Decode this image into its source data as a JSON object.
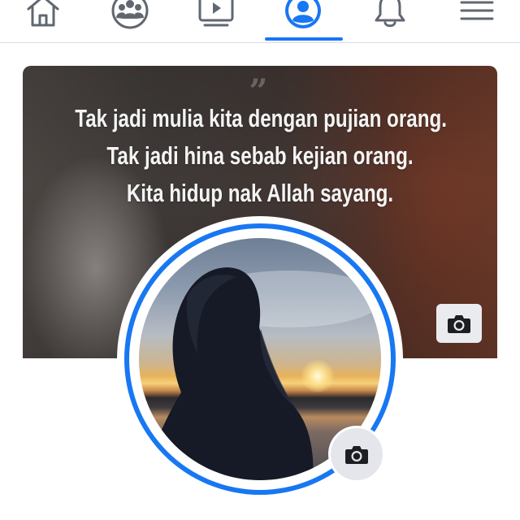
{
  "nav": {
    "items": [
      {
        "name": "home",
        "icon": "home-icon"
      },
      {
        "name": "groups",
        "icon": "groups-icon"
      },
      {
        "name": "watch",
        "icon": "video-icon"
      },
      {
        "name": "profile",
        "icon": "profile-icon",
        "active": true
      },
      {
        "name": "notifications",
        "icon": "bell-icon"
      },
      {
        "name": "menu",
        "icon": "hamburger-menu-icon"
      }
    ]
  },
  "cover": {
    "quote_mark": "”",
    "quote_lines": [
      "Tak jadi mulia kita dengan pujian orang.",
      "Tak jadi hina sebab kejian orang.",
      "Kita hidup nak Allah sayang."
    ],
    "camera_icon": "camera-icon"
  },
  "profile": {
    "camera_icon": "camera-icon"
  },
  "colors": {
    "accent": "#1877f2",
    "icon_gray": "#606770",
    "button_bg": "#e4e6eb"
  }
}
